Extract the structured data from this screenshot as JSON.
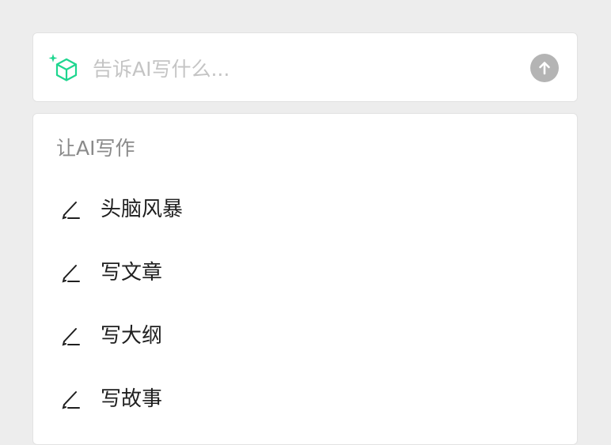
{
  "prompt": {
    "icon": "ai-sparkle-cube-icon",
    "placeholder": "告诉AI写什么...",
    "value": "",
    "send_icon": "arrow-up-icon",
    "accent_color": "#1ed68f"
  },
  "menu": {
    "heading": "让AI写作",
    "items": [
      {
        "label": "头脑风暴",
        "icon": "pen-icon"
      },
      {
        "label": "写文章",
        "icon": "pen-icon"
      },
      {
        "label": "写大纲",
        "icon": "pen-icon"
      },
      {
        "label": "写故事",
        "icon": "pen-icon"
      }
    ]
  }
}
